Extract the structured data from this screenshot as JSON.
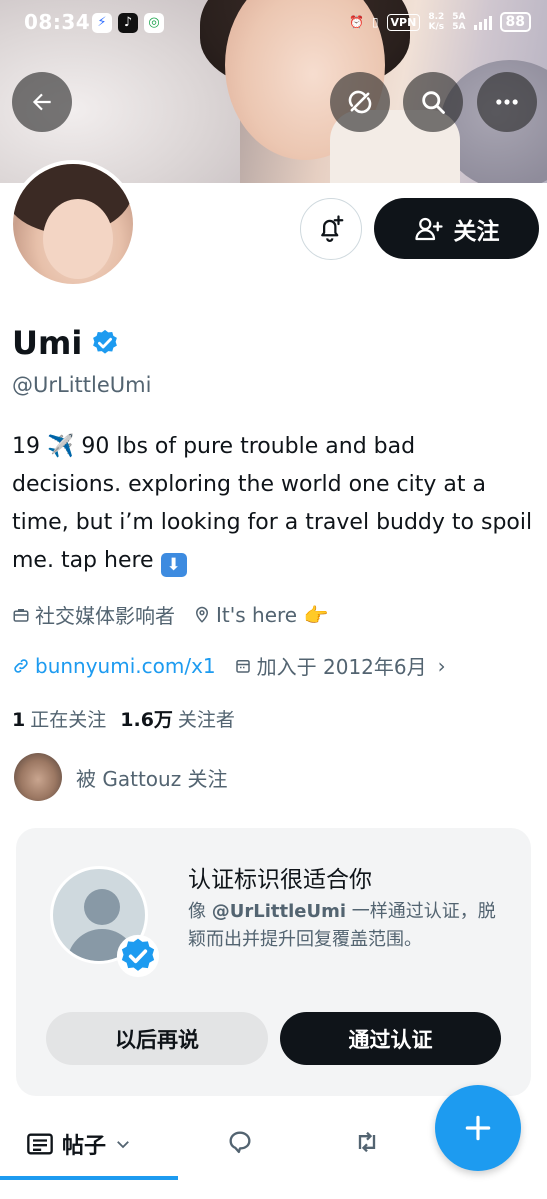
{
  "status_bar": {
    "time": "08:34",
    "vpn": "VPN",
    "net_speed_top": "8.2",
    "net_speed_bottom": "K/s",
    "sim_label_top": "5A",
    "sim_label_bottom": "5A",
    "battery": "88"
  },
  "banner_icons": [
    "back-arrow-icon",
    "translate-icon",
    "search-icon",
    "more-icon"
  ],
  "profile": {
    "name": "Umi",
    "handle": "@UrLittleUmi",
    "bio_line1_prefix": "19 ✈️ 90 lbs of pure trouble and bad",
    "bio_line2": "decisions. exploring the world one city at a",
    "bio_line3": "time, but i’m looking for a travel buddy to spoil",
    "bio_line4_prefix": "me. tap here",
    "bio_emoji": "⬇",
    "category": "社交媒体影响者",
    "location": "It's here 👉",
    "website": "bunnyumi.com/x1",
    "joined": "加入于 2012年6月",
    "following_count": "1",
    "following_label": "正在关注",
    "followers_count": "1.6万",
    "followers_label": "关注者",
    "followed_by": "被 Gattouz 关注"
  },
  "actions": {
    "follow_label": "关注"
  },
  "verify_card": {
    "title": "认证标识很适合你",
    "text_prefix": "像 ",
    "text_handle": "@UrLittleUmi",
    "text_suffix": " 一样通过认证，脱颖而出并提升回复覆盖范围。",
    "later_label": "以后再说",
    "verify_label": "通过认证"
  },
  "tabs": {
    "posts_label": "帖子"
  },
  "colors": {
    "accent": "#1d9bf0",
    "text": "#0f1419",
    "secondary": "#536471"
  }
}
